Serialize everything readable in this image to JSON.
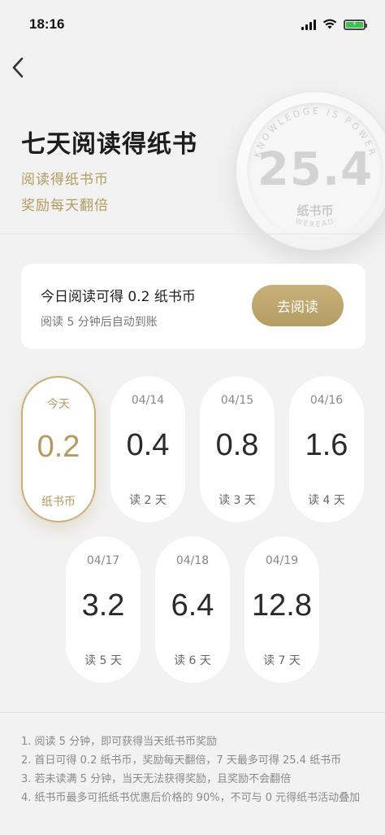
{
  "status_bar": {
    "time": "18:16",
    "battery_icon": "battery-charging-icon"
  },
  "header": {
    "title": "七天阅读得纸书",
    "subtitle_line1": "阅读得纸书币",
    "subtitle_line2": "奖励每天翻倍"
  },
  "coin": {
    "ring_text_top": "KNOWLEDGE IS POWER",
    "ring_text_bottom": "WEREAD",
    "amount": "25.4",
    "unit": "纸书币"
  },
  "today_card": {
    "main_text": "今日阅读可得 0.2 纸书币",
    "sub_text": "阅读 5 分钟后自动到账",
    "button_label": "去阅读"
  },
  "days": [
    {
      "date": "今天",
      "amount": "0.2",
      "caption": "纸书币",
      "active": true
    },
    {
      "date": "04/14",
      "amount": "0.4",
      "caption": "读 2 天"
    },
    {
      "date": "04/15",
      "amount": "0.8",
      "caption": "读 3 天"
    },
    {
      "date": "04/16",
      "amount": "1.6",
      "caption": "读 4 天"
    },
    {
      "date": "04/17",
      "amount": "3.2",
      "caption": "读 5 天"
    },
    {
      "date": "04/18",
      "amount": "6.4",
      "caption": "读 6 天"
    },
    {
      "date": "04/19",
      "amount": "12.8",
      "caption": "读 7 天"
    }
  ],
  "rules": [
    "1. 阅读 5 分钟，即可获得当天纸书币奖励",
    "2. 首日可得 0.2 纸书币，奖励每天翻倍，7 天最多可得 25.4 纸书币",
    "3. 若未读满 5 分钟，当天无法获得奖励，且奖励不会翻倍",
    "4. 纸书币最多可抵纸书优惠后价格的 90%，不可与 0 元得纸书活动叠加"
  ],
  "colors": {
    "accent": "#b49a5e",
    "background": "#f2f2f2"
  }
}
